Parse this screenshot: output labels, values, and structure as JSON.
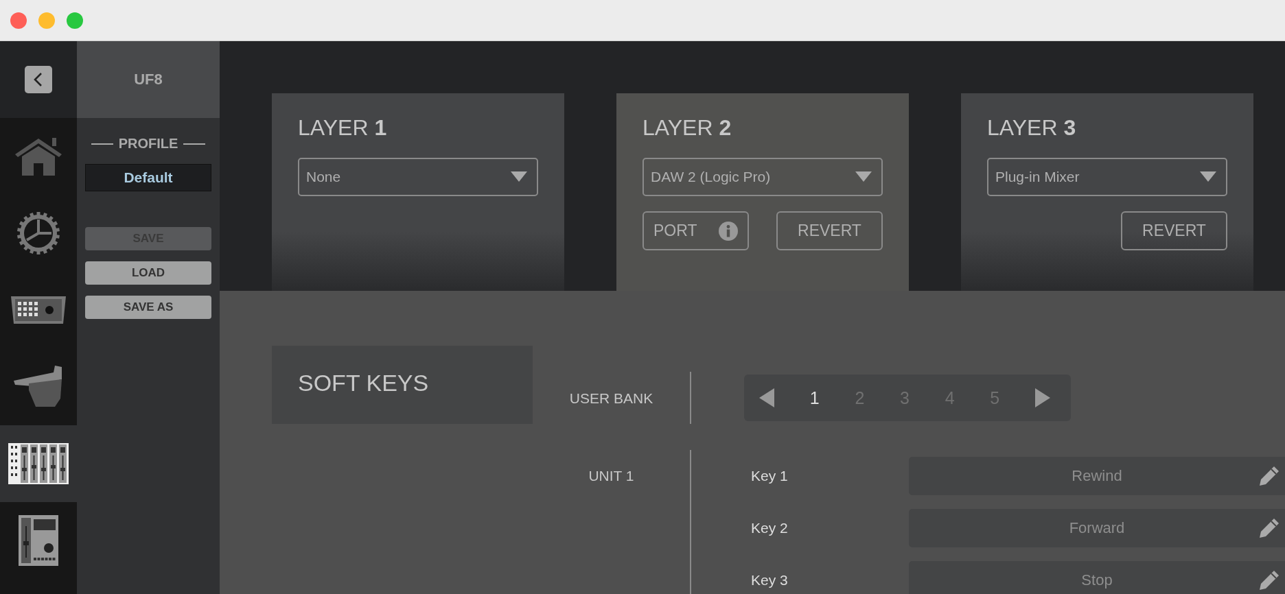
{
  "window": {
    "controls": [
      {
        "kind": "close"
      },
      {
        "kind": "minimize"
      },
      {
        "kind": "zoom"
      }
    ]
  },
  "sidebar": {
    "items": [
      {
        "kind": "home",
        "selected": false
      },
      {
        "kind": "gear",
        "selected": false
      },
      {
        "kind": "console",
        "selected": false
      },
      {
        "kind": "fader",
        "selected": false
      },
      {
        "kind": "mixer",
        "selected": true
      },
      {
        "kind": "controller",
        "selected": false
      }
    ]
  },
  "profile_panel": {
    "device": "UF8",
    "section_title": "PROFILE",
    "profile_name": "Default",
    "buttons": [
      {
        "label": "SAVE",
        "disabled": true
      },
      {
        "label": "LOAD",
        "disabled": false
      },
      {
        "label": "SAVE AS",
        "disabled": false
      }
    ]
  },
  "layers": [
    {
      "title": "LAYER **1**",
      "selected": false,
      "dropdown": "None"
    },
    {
      "title": "LAYER **2**",
      "selected": true,
      "dropdown": "DAW 2 (Logic Pro)",
      "buttons": [
        {
          "kind": "port",
          "label": "PORT"
        },
        {
          "kind": "revert",
          "label": "REVERT"
        }
      ]
    },
    {
      "title": "LAYER **3**",
      "selected": false,
      "dropdown": "Plug-in Mixer",
      "buttons": [
        {
          "kind": "revert",
          "label": "REVERT"
        }
      ]
    }
  ],
  "soft_keys": {
    "title": "SOFT KEYS",
    "user_bank_label": "USER BANK",
    "banks": [
      {
        "label": "1",
        "selected": true
      },
      {
        "label": "2",
        "selected": false
      },
      {
        "label": "3",
        "selected": false
      },
      {
        "label": "4",
        "selected": false
      },
      {
        "label": "5",
        "selected": false
      }
    ],
    "unit_label": "UNIT 1",
    "keys": [
      {
        "label": "Key 1",
        "value": "Rewind"
      },
      {
        "label": "Key 2",
        "value": "Forward"
      },
      {
        "label": "Key 3",
        "value": "Stop"
      }
    ]
  }
}
